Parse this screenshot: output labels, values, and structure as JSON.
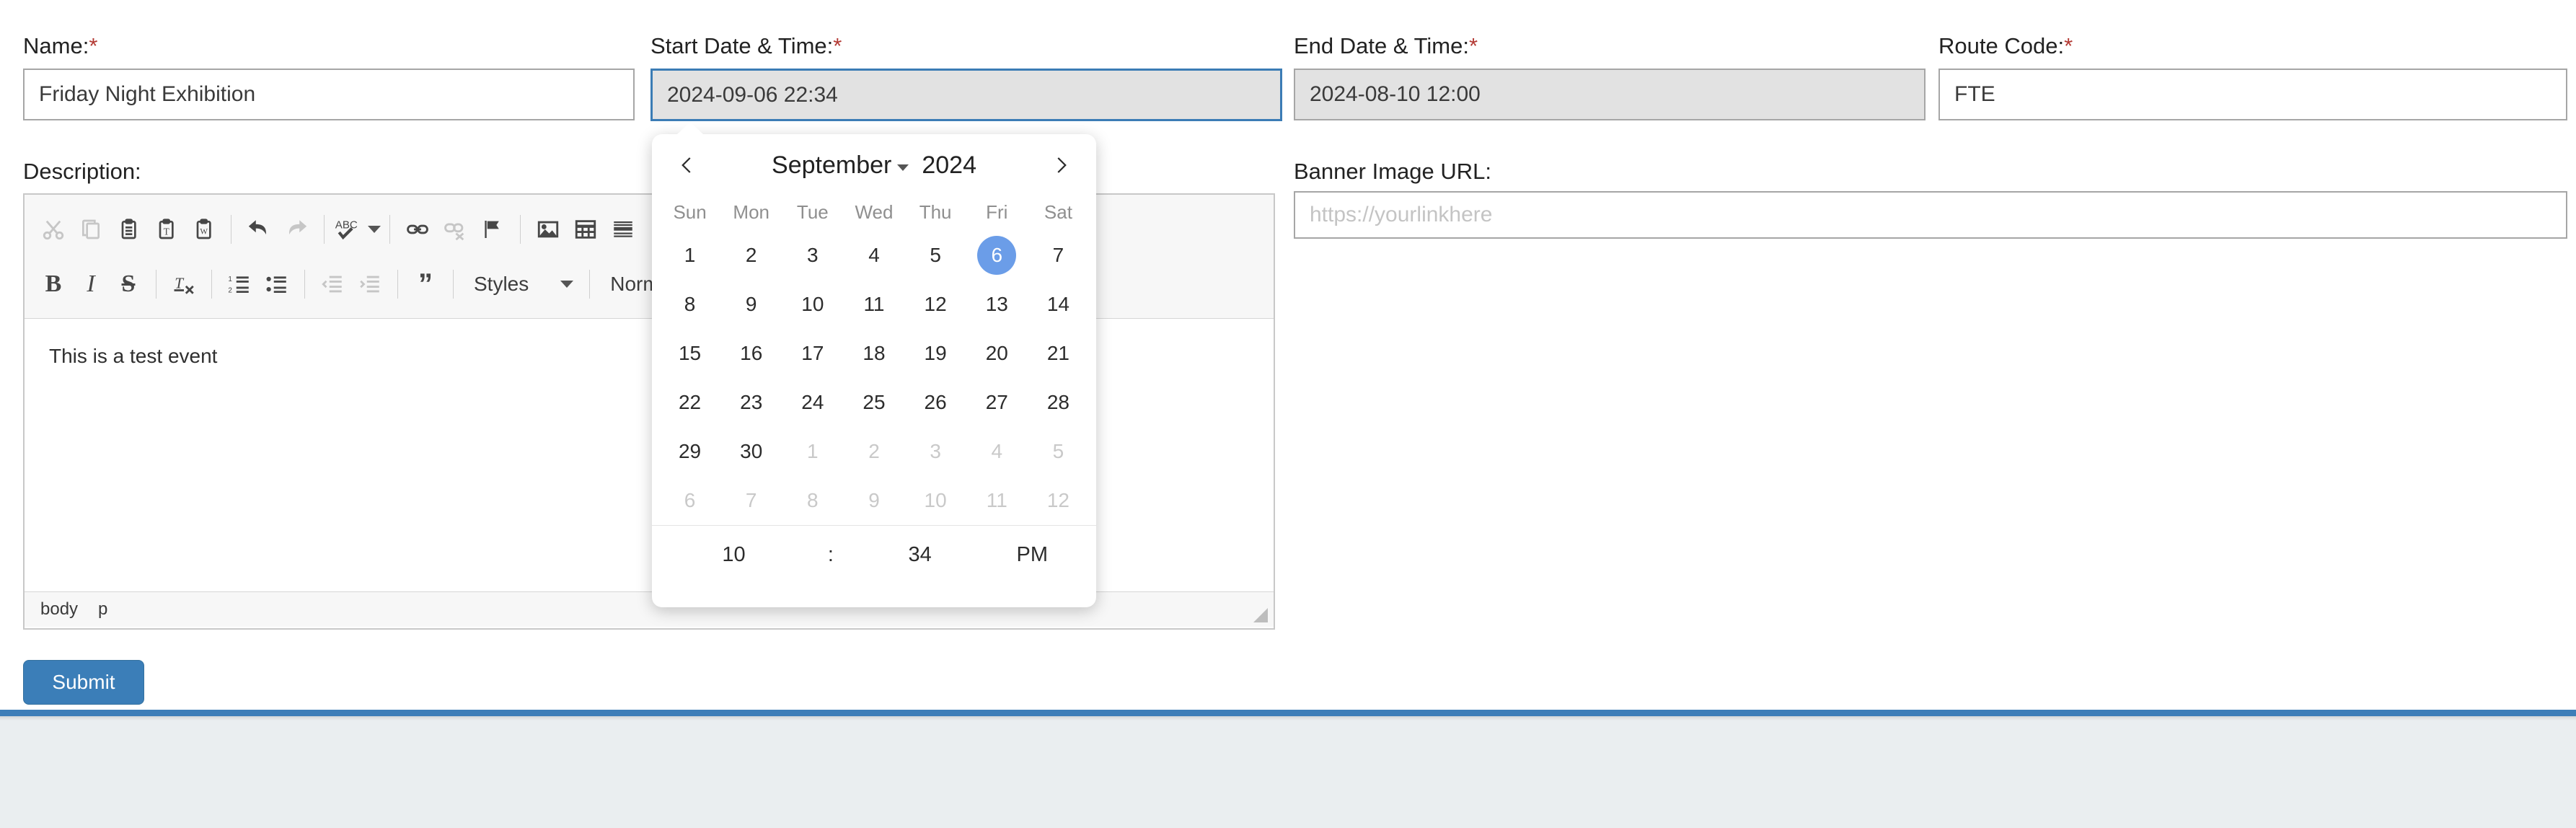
{
  "fields": {
    "name": {
      "label": "Name:",
      "required_marker": "*",
      "value": "Friday Night Exhibition"
    },
    "start_datetime": {
      "label": "Start Date & Time:",
      "required_marker": "*",
      "value": "2024-09-06 22:34"
    },
    "end_datetime": {
      "label": "End Date & Time:",
      "required_marker": "*",
      "value": "2024-08-10 12:00"
    },
    "route_code": {
      "label": "Route Code:",
      "required_marker": "*",
      "value": "FTE"
    },
    "description": {
      "label": "Description:"
    },
    "banner_image_url": {
      "label": "Banner Image URL:",
      "value": "",
      "placeholder": "https://yourlinkhere"
    }
  },
  "editor": {
    "content": "This is a test event",
    "styles_label": "Styles",
    "format_label": "Normal",
    "status_path": [
      "body",
      "p"
    ],
    "toolbar_row1": [
      {
        "name": "cut-icon",
        "label": "Cut",
        "disabled": true
      },
      {
        "name": "copy-icon",
        "label": "Copy",
        "disabled": true
      },
      {
        "name": "paste-icon",
        "label": "Paste",
        "disabled": false
      },
      {
        "name": "paste-as-plain-text-icon",
        "label": "Paste as plain text",
        "disabled": false
      },
      {
        "name": "paste-from-word-icon",
        "label": "Paste from Word",
        "disabled": false
      },
      {
        "name": "undo-icon",
        "label": "Undo",
        "disabled": false
      },
      {
        "name": "redo-icon",
        "label": "Redo",
        "disabled": true
      },
      {
        "name": "spellcheck-icon",
        "label": "Spell Check As You Type",
        "disabled": false
      },
      {
        "name": "link-icon",
        "label": "Link",
        "disabled": false
      },
      {
        "name": "unlink-icon",
        "label": "Unlink",
        "disabled": true
      },
      {
        "name": "anchor-flag-icon",
        "label": "Anchor",
        "disabled": false
      },
      {
        "name": "image-icon",
        "label": "Image",
        "disabled": false
      },
      {
        "name": "table-icon",
        "label": "Table",
        "disabled": false
      },
      {
        "name": "horizontal-rule-icon",
        "label": "Horizontal Line",
        "disabled": false
      }
    ],
    "toolbar_row2": [
      {
        "name": "bold-icon",
        "label": "Bold",
        "disabled": false
      },
      {
        "name": "italic-icon",
        "label": "Italic",
        "disabled": false
      },
      {
        "name": "strikethrough-icon",
        "label": "Strike Through",
        "disabled": false
      },
      {
        "name": "remove-format-icon",
        "label": "Remove Format",
        "disabled": false
      },
      {
        "name": "numbered-list-icon",
        "label": "Insert/Remove Numbered List",
        "disabled": false
      },
      {
        "name": "bulleted-list-icon",
        "label": "Insert/Remove Bulleted List",
        "disabled": false
      },
      {
        "name": "decrease-indent-icon",
        "label": "Decrease Indent",
        "disabled": true
      },
      {
        "name": "increase-indent-icon",
        "label": "Increase Indent",
        "disabled": true
      },
      {
        "name": "blockquote-icon",
        "label": "Block Quote",
        "disabled": false
      }
    ]
  },
  "datepicker": {
    "prev_label": "‹",
    "next_label": "›",
    "month": "September",
    "year": "2024",
    "weekdays": [
      "Sun",
      "Mon",
      "Tue",
      "Wed",
      "Thu",
      "Fri",
      "Sat"
    ],
    "weeks": [
      [
        {
          "d": "1",
          "muted": false,
          "selected": false
        },
        {
          "d": "2",
          "muted": false,
          "selected": false
        },
        {
          "d": "3",
          "muted": false,
          "selected": false
        },
        {
          "d": "4",
          "muted": false,
          "selected": false
        },
        {
          "d": "5",
          "muted": false,
          "selected": false
        },
        {
          "d": "6",
          "muted": false,
          "selected": true
        },
        {
          "d": "7",
          "muted": false,
          "selected": false
        }
      ],
      [
        {
          "d": "8",
          "muted": false,
          "selected": false
        },
        {
          "d": "9",
          "muted": false,
          "selected": false
        },
        {
          "d": "10",
          "muted": false,
          "selected": false
        },
        {
          "d": "11",
          "muted": false,
          "selected": false
        },
        {
          "d": "12",
          "muted": false,
          "selected": false
        },
        {
          "d": "13",
          "muted": false,
          "selected": false
        },
        {
          "d": "14",
          "muted": false,
          "selected": false
        }
      ],
      [
        {
          "d": "15",
          "muted": false,
          "selected": false
        },
        {
          "d": "16",
          "muted": false,
          "selected": false
        },
        {
          "d": "17",
          "muted": false,
          "selected": false
        },
        {
          "d": "18",
          "muted": false,
          "selected": false
        },
        {
          "d": "19",
          "muted": false,
          "selected": false
        },
        {
          "d": "20",
          "muted": false,
          "selected": false
        },
        {
          "d": "21",
          "muted": false,
          "selected": false
        }
      ],
      [
        {
          "d": "22",
          "muted": false,
          "selected": false
        },
        {
          "d": "23",
          "muted": false,
          "selected": false
        },
        {
          "d": "24",
          "muted": false,
          "selected": false
        },
        {
          "d": "25",
          "muted": false,
          "selected": false
        },
        {
          "d": "26",
          "muted": false,
          "selected": false
        },
        {
          "d": "27",
          "muted": false,
          "selected": false
        },
        {
          "d": "28",
          "muted": false,
          "selected": false
        }
      ],
      [
        {
          "d": "29",
          "muted": false,
          "selected": false
        },
        {
          "d": "30",
          "muted": false,
          "selected": false
        },
        {
          "d": "1",
          "muted": true,
          "selected": false
        },
        {
          "d": "2",
          "muted": true,
          "selected": false
        },
        {
          "d": "3",
          "muted": true,
          "selected": false
        },
        {
          "d": "4",
          "muted": true,
          "selected": false
        },
        {
          "d": "5",
          "muted": true,
          "selected": false
        }
      ],
      [
        {
          "d": "6",
          "muted": true,
          "selected": false
        },
        {
          "d": "7",
          "muted": true,
          "selected": false
        },
        {
          "d": "8",
          "muted": true,
          "selected": false
        },
        {
          "d": "9",
          "muted": true,
          "selected": false
        },
        {
          "d": "10",
          "muted": true,
          "selected": false
        },
        {
          "d": "11",
          "muted": true,
          "selected": false
        },
        {
          "d": "12",
          "muted": true,
          "selected": false
        }
      ]
    ],
    "time": {
      "hour": "10",
      "separator": ":",
      "minute": "34",
      "meridiem": "PM"
    }
  },
  "actions": {
    "submit_label": "Submit"
  },
  "colors": {
    "accent_blue": "#3b7eb8",
    "selected_day_blue": "#6b9de8",
    "required_red": "#b33a34",
    "page_background": "#eaeef0"
  }
}
